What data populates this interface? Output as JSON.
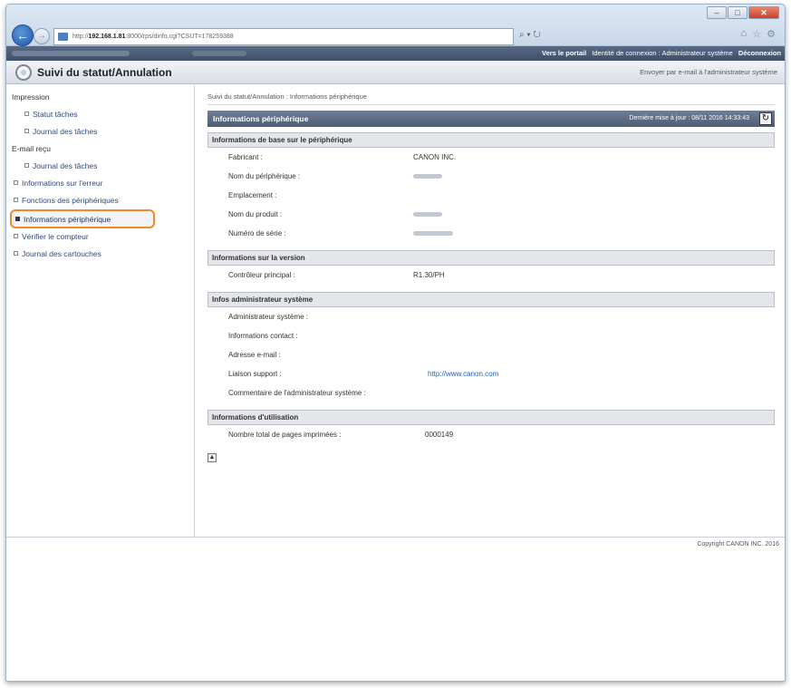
{
  "browser": {
    "url_prefix": "http://",
    "url_host": "192.168.1.81",
    "url_rest": ":8000/rps/dinfo.cgi?CSUT=178259388",
    "search_glyph": "⌕ ▾ ↻",
    "window_controls": [
      "–",
      "□",
      "✕"
    ],
    "toolbar_icons": [
      "⌂",
      "☆",
      "⚙"
    ]
  },
  "header": {
    "portal_link": "Vers le portail",
    "login_identity": "Identité de connexion : Administrateur système",
    "logout": "Déconnexion",
    "page_title": "Suivi du statut/Annulation",
    "email_link": "Envoyer par e-mail à l'administrateur système"
  },
  "sidebar": {
    "impression": "Impression",
    "statut_taches": "Statut tâches",
    "journal_taches_1": "Journal des tâches",
    "email_recu": "E-mail reçu",
    "journal_taches_2": "Journal des tâches",
    "infos_erreur": "Informations sur l'erreur",
    "fonctions": "Fonctions des périphériques",
    "infos_peripherique": "Informations périphérique",
    "compteur": "Vérifier le compteur",
    "cartouches": "Journal des cartouches"
  },
  "main": {
    "breadcrumb": "Suivi du statut/Annulation : Informations périphérique",
    "panel_title": "Informations périphérique",
    "last_update": "Dernière mise à jour : 08/11 2016 14:33:43",
    "refresh_glyph": "↻",
    "base_section": "Informations de base sur le périphérique",
    "fabricant_label": "Fabricant :",
    "fabricant_value": "CANON INC.",
    "nom_periph_label": "Nom du périphérique :",
    "emplacement_label": "Emplacement :",
    "nom_produit_label": "Nom du produit :",
    "numero_serie_label": "Numéro de série :",
    "version_section": "Informations sur la version",
    "controleur_label": "Contrôleur principal :",
    "controleur_value": "R1.30/PH",
    "admin_section": "Infos administrateur système",
    "admin_label": "Administrateur système :",
    "contact_label": "Informations contact :",
    "email_label": "Adresse e-mail :",
    "liaison_label": "Liaison support :",
    "liaison_value": "http://www.canon.com",
    "commentaire_label": "Commentaire de l'administrateur système :",
    "usage_section": "Informations d'utilisation",
    "pages_label": "Nombre total de pages imprimées :",
    "pages_value": "0000149",
    "back_top_glyph": "▲"
  },
  "footer": {
    "copyright": "Copyright CANON INC. 2016"
  }
}
